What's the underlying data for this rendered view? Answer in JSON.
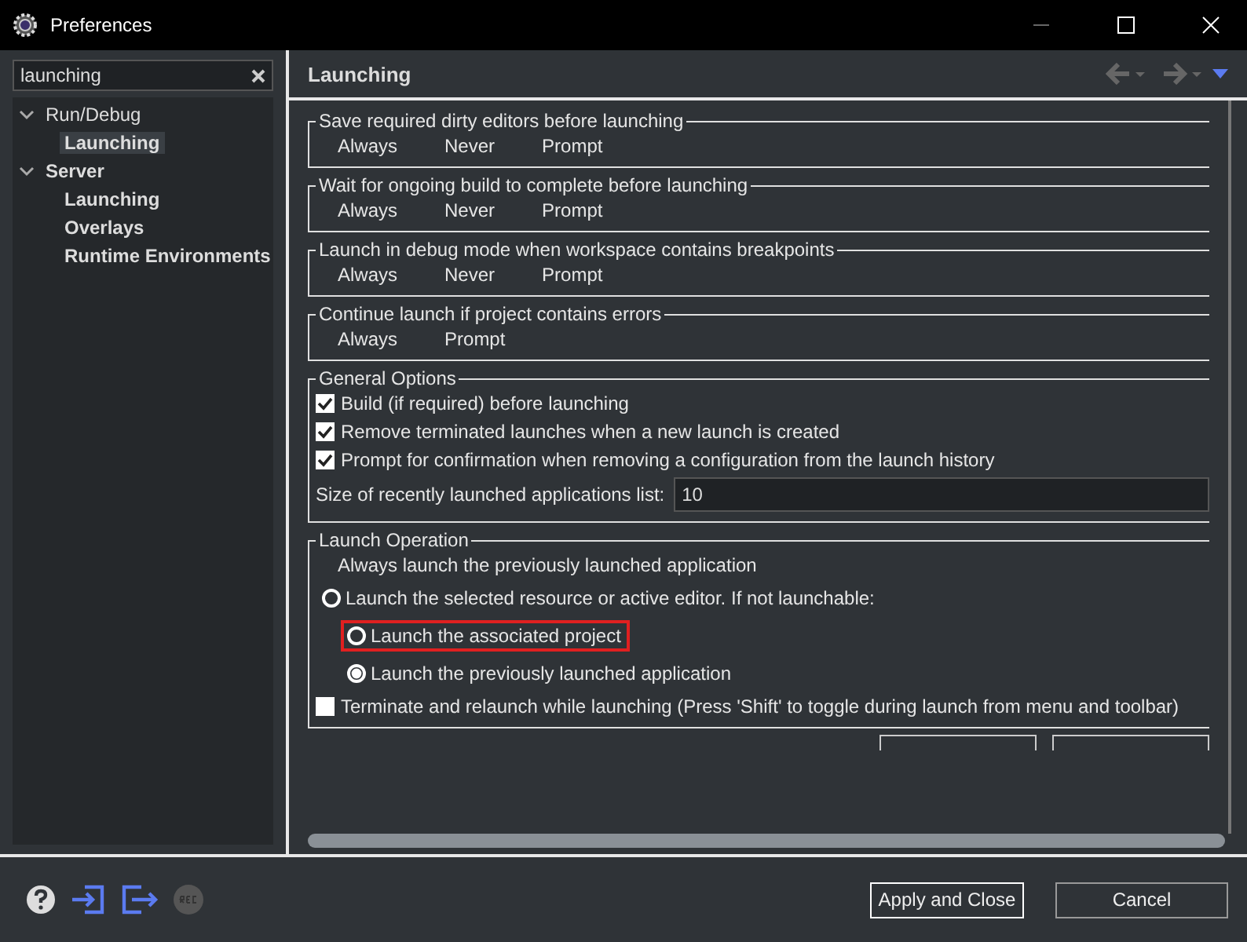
{
  "window": {
    "title": "Preferences"
  },
  "search": {
    "value": "launching"
  },
  "tree": [
    {
      "label": "Run/Debug",
      "expanded": true,
      "selected": false,
      "children": [
        {
          "label": "Launching",
          "selected": true
        }
      ]
    },
    {
      "label": "Server",
      "expanded": true,
      "selected": false,
      "children": [
        {
          "label": "Launching",
          "selected": false
        },
        {
          "label": "Overlays",
          "selected": false
        },
        {
          "label": "Runtime Environments",
          "selected": false
        }
      ]
    }
  ],
  "page": {
    "title": "Launching"
  },
  "choice_groups": [
    {
      "title": "Save required dirty editors before launching",
      "options": [
        "Always",
        "Never",
        "Prompt"
      ]
    },
    {
      "title": "Wait for ongoing build to complete before launching",
      "options": [
        "Always",
        "Never",
        "Prompt"
      ]
    },
    {
      "title": "Launch in debug mode when workspace contains breakpoints",
      "options": [
        "Always",
        "Never",
        "Prompt"
      ]
    },
    {
      "title": "Continue launch if project contains errors",
      "options": [
        "Always",
        "Prompt"
      ]
    }
  ],
  "general_options": {
    "title": "General Options",
    "checks": [
      {
        "label": "Build (if required) before launching",
        "checked": true
      },
      {
        "label": "Remove terminated launches when a new launch is created",
        "checked": true
      },
      {
        "label": "Prompt for confirmation when removing a configuration from the launch history",
        "checked": true
      }
    ],
    "size_label": "Size of recently launched applications list:",
    "size_value": "10"
  },
  "launch_operation": {
    "title": "Launch Operation",
    "note": "Always launch the previously launched application",
    "items": [
      {
        "kind": "radio",
        "label": "Launch the selected resource or active editor. If not launchable:",
        "selected": false,
        "focused": false,
        "children": [
          {
            "kind": "radio",
            "label": "Launch the associated project",
            "selected": false,
            "focused": true
          },
          {
            "kind": "radio",
            "label": "Launch the previously launched application",
            "selected": true,
            "focused": false
          }
        ]
      },
      {
        "kind": "checkbox",
        "label": "Terminate and relaunch while launching (Press 'Shift' to toggle during launch from menu and toolbar)",
        "checked": false
      }
    ]
  },
  "buttons": [
    "Apply and Close",
    "Cancel"
  ]
}
